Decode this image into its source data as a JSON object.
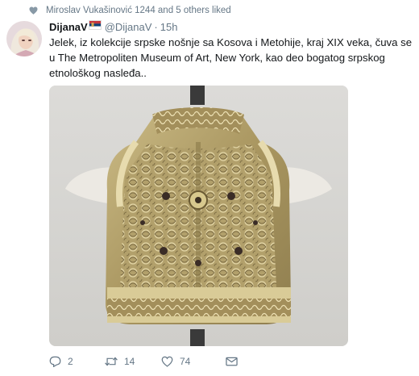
{
  "social_context": {
    "icon": "heart-icon",
    "text": "Miroslav Vukašinović 1244 and 5 others liked"
  },
  "tweet": {
    "display_name": "DijanaV",
    "flag": "serbian-flag",
    "handle": "@DijanaV",
    "separator": "·",
    "time": "15h",
    "text": "Jelek, iz kolekcije srpske nošnje sa Kosova i Metohije, kraj XIX veka, čuva se u The Metropoliten Museum of Art, New York, kao deo bogatog srpskog etnološkog nasleđa..",
    "media": {
      "description_icon": "embroidered-vest-photo"
    }
  },
  "actions": {
    "reply": {
      "icon": "reply-icon",
      "count": "2"
    },
    "retweet": {
      "icon": "retweet-icon",
      "count": "14"
    },
    "like": {
      "icon": "heart-outline-icon",
      "count": "74"
    },
    "message": {
      "icon": "envelope-icon"
    }
  },
  "colors": {
    "secondary_text": "#657786",
    "primary_text": "#14171a",
    "gold": "#b5a268"
  }
}
